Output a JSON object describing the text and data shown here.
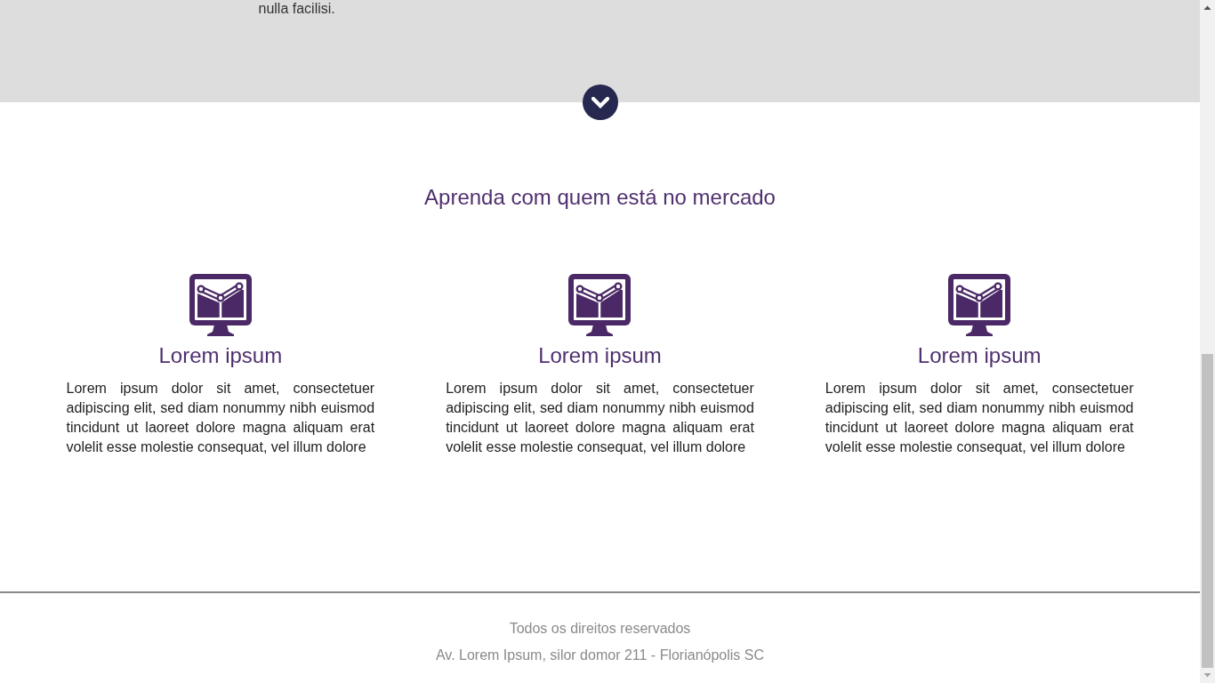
{
  "intro": {
    "text": "nulla facilisi."
  },
  "section": {
    "title": "Aprenda com quem está no mercado",
    "features": [
      {
        "title": "Lorem ipsum",
        "text": "Lorem ipsum dolor sit amet, consectetuer adipiscing elit, sed diam nonummy nibh euismod tincidunt ut laoreet dolore magna aliquam erat volelit esse molestie consequat, vel illum dolore"
      },
      {
        "title": "Lorem ipsum",
        "text": "Lorem ipsum dolor sit amet, consectetuer adipiscing elit, sed diam nonummy nibh euismod tincidunt ut laoreet dolore magna aliquam erat volelit esse molestie consequat, vel illum dolore"
      },
      {
        "title": "Lorem ipsum",
        "text": "Lorem ipsum dolor sit amet, consectetuer adipiscing elit, sed diam nonummy nibh euismod tincidunt ut laoreet dolore magna aliquam erat volelit esse molestie consequat, vel illum dolore"
      }
    ]
  },
  "footer": {
    "copyright": "Todos os direitos reservados",
    "address": "Av. Lorem Ipsum, silor domor 211 - Florianópolis SC"
  }
}
